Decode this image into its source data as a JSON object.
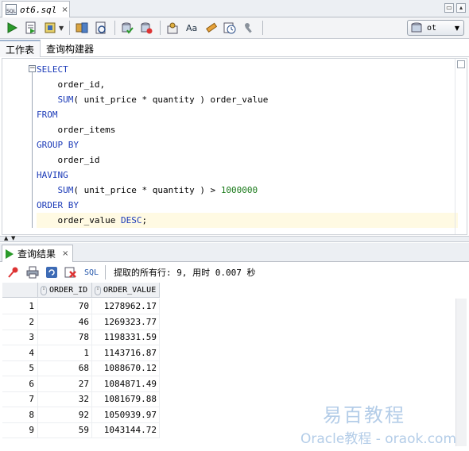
{
  "file_tab": {
    "name": "ot6.sql",
    "icon": "sql-file-icon",
    "close_label": "×"
  },
  "window_controls": {
    "restore": "▭",
    "close": "▴"
  },
  "toolbar": {
    "connection": "ot",
    "buttons": [
      "run-statement-icon",
      "run-script-icon",
      "autotrace-icon",
      "explain-plan-icon",
      "sql-tuning-icon",
      "commit-icon",
      "rollback-icon",
      "unshared-sql-icon",
      "format-icon",
      "clear-icon",
      "history-icon",
      "tools-icon"
    ]
  },
  "sub_tabs": [
    "工作表",
    "查询构建器"
  ],
  "editor": {
    "lines": [
      [
        {
          "t": "SELECT",
          "c": "kw"
        }
      ],
      [
        {
          "t": "    order_id,",
          "c": ""
        }
      ],
      [
        {
          "t": "    ",
          "c": ""
        },
        {
          "t": "SUM",
          "c": "fn"
        },
        {
          "t": "( unit_price * quantity ) order_value",
          "c": ""
        }
      ],
      [
        {
          "t": "FROM",
          "c": "kw"
        }
      ],
      [
        {
          "t": "    order_items",
          "c": ""
        }
      ],
      [
        {
          "t": "GROUP BY",
          "c": "kw"
        }
      ],
      [
        {
          "t": "    order_id",
          "c": ""
        }
      ],
      [
        {
          "t": "HAVING",
          "c": "kw"
        }
      ],
      [
        {
          "t": "    ",
          "c": ""
        },
        {
          "t": "SUM",
          "c": "fn"
        },
        {
          "t": "( unit_price * quantity ) > ",
          "c": ""
        },
        {
          "t": "1000000",
          "c": "num"
        }
      ],
      [
        {
          "t": "ORDER BY",
          "c": "kw"
        }
      ],
      [
        {
          "t": "    order_value ",
          "c": ""
        },
        {
          "t": "DESC",
          "c": "kw"
        },
        {
          "t": ";",
          "c": ""
        }
      ]
    ],
    "current_line": 10
  },
  "result": {
    "tab_label": "查询结果",
    "close_label": "×",
    "sql_link": "SQL",
    "status": "提取的所有行: 9, 用时 0.007 秒",
    "columns": [
      "ORDER_ID",
      "ORDER_VALUE"
    ],
    "rows": [
      [
        "1",
        "70",
        "1278962.17"
      ],
      [
        "2",
        "46",
        "1269323.77"
      ],
      [
        "3",
        "78",
        "1198331.59"
      ],
      [
        "4",
        "1",
        "1143716.87"
      ],
      [
        "5",
        "68",
        "1088670.12"
      ],
      [
        "6",
        "27",
        "1084871.49"
      ],
      [
        "7",
        "32",
        "1081679.88"
      ],
      [
        "8",
        "92",
        "1050939.97"
      ],
      [
        "9",
        "59",
        "1043144.72"
      ]
    ]
  },
  "watermark": {
    "cn": "易百教程",
    "en": "Oracle教程 - oraok.com"
  }
}
